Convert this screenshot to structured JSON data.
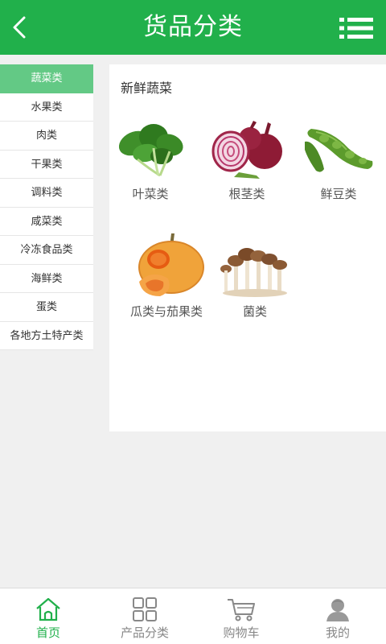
{
  "header": {
    "title": "货品分类",
    "back_icon": "chevron-left-icon",
    "menu_icon": "list-menu-icon",
    "color": "#21b04b"
  },
  "sidebar": {
    "items": [
      {
        "label": "蔬菜类",
        "active": true
      },
      {
        "label": "水果类"
      },
      {
        "label": "肉类"
      },
      {
        "label": "干果类"
      },
      {
        "label": "调料类"
      },
      {
        "label": "咸菜类"
      },
      {
        "label": "冷冻食品类"
      },
      {
        "label": "海鲜类"
      },
      {
        "label": "蛋类"
      },
      {
        "label": "各地方土特产类"
      }
    ],
    "active_color": "#63c985"
  },
  "main": {
    "section_title": "新鲜蔬菜",
    "categories": [
      {
        "label": "叶菜类",
        "icon": "spinach-image"
      },
      {
        "label": "根茎类",
        "icon": "onion-image"
      },
      {
        "label": "鲜豆类",
        "icon": "broad-bean-image"
      },
      {
        "label": "瓜类与茄果类",
        "icon": "pumpkin-image"
      },
      {
        "label": "菌类",
        "icon": "mushroom-image"
      }
    ]
  },
  "tabbar": {
    "tabs": [
      {
        "label": "首页",
        "icon": "home-icon",
        "active": true
      },
      {
        "label": "产品分类",
        "icon": "grid-icon"
      },
      {
        "label": "购物车",
        "icon": "cart-icon"
      },
      {
        "label": "我的",
        "icon": "user-icon"
      }
    ],
    "active_color": "#21b04b",
    "inactive_color": "#888888"
  }
}
